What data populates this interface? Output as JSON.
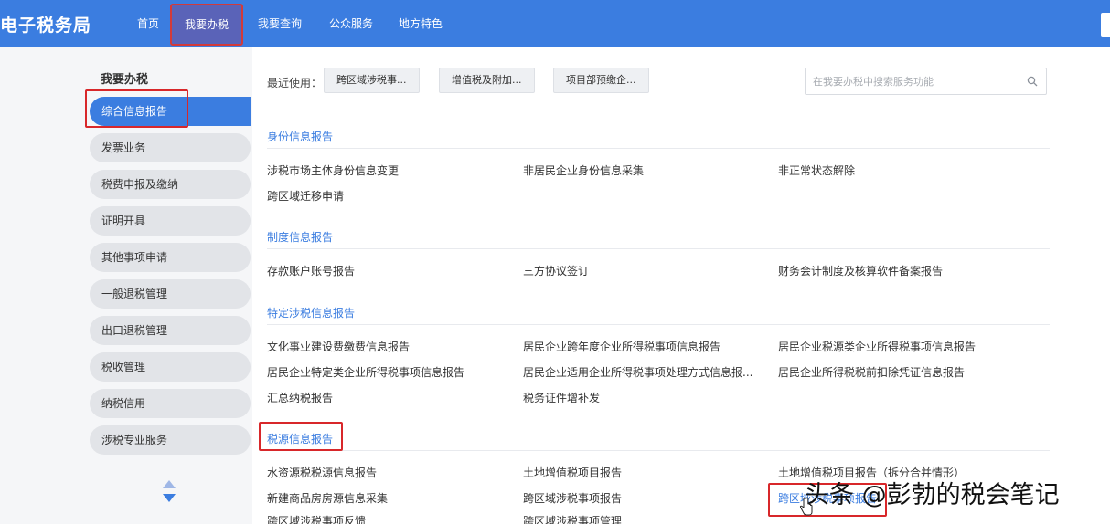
{
  "header": {
    "brand": "电子税务局",
    "nav": [
      "首页",
      "我要办税",
      "我要查询",
      "公众服务",
      "地方特色"
    ]
  },
  "sidebar": {
    "title": "我要办税",
    "items": [
      "综合信息报告",
      "发票业务",
      "税费申报及缴纳",
      "证明开具",
      "其他事项申请",
      "一般退税管理",
      "出口退税管理",
      "税收管理",
      "纳税信用",
      "涉税专业服务"
    ]
  },
  "recent": {
    "label": "最近使用：",
    "items": [
      "跨区域涉税事...",
      "增值税及附加...",
      "项目部预缴企..."
    ]
  },
  "search": {
    "placeholder": "在我要办税中搜索服务功能"
  },
  "sections": [
    {
      "title": "身份信息报告",
      "links": [
        "涉税市场主体身份信息变更",
        "非居民企业身份信息采集",
        "非正常状态解除",
        "跨区域迁移申请"
      ]
    },
    {
      "title": "制度信息报告",
      "links": [
        "存款账户账号报告",
        "三方协议签订",
        "财务会计制度及核算软件备案报告"
      ]
    },
    {
      "title": "特定涉税信息报告",
      "links": [
        "文化事业建设费缴费信息报告",
        "居民企业跨年度企业所得税事项信息报告",
        "居民企业税源类企业所得税事项信息报告",
        "居民企业特定类企业所得税事项信息报告",
        "居民企业适用企业所得税事项处理方式信息报...",
        "居民企业所得税税前扣除凭证信息报告",
        "汇总纳税报告",
        "税务证件增补发"
      ]
    },
    {
      "title": "税源信息报告",
      "links": [
        "水资源税税源信息报告",
        "土地增值税项目报告",
        "土地增值税项目报告（拆分合并情形）",
        "新建商品房房源信息采集",
        "跨区域涉税事项报告",
        "跨区域涉税事项报告",
        "跨区域涉税事项反馈",
        "跨区域涉税事项管理"
      ]
    }
  ],
  "watermark": "头条 @彭勃的税会笔记",
  "colors": {
    "header_blue": "#3b7de0",
    "annotation_red": "#d8272a",
    "section_blue": "#3b7de0"
  }
}
